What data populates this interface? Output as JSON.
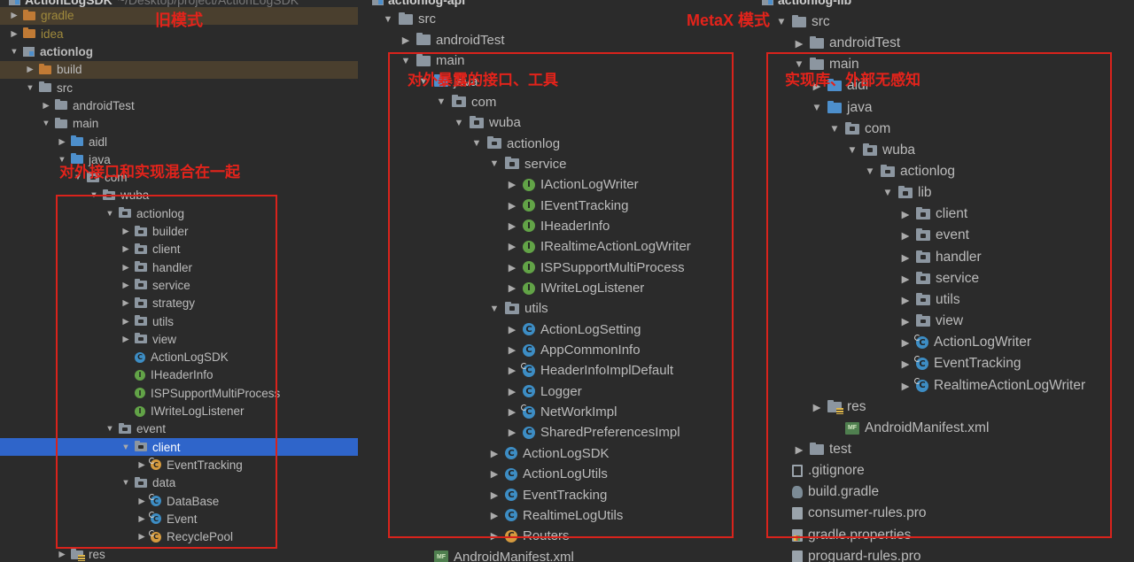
{
  "panel1": {
    "module_name": "ActionLogSDK",
    "module_path": "~/Desktop/project/ActionLogSDK",
    "annotation_top": "旧模式",
    "annotation_box": "对外接口和实现混合在一起",
    "rows": [
      {
        "indent": 1,
        "arrow": "▶",
        "icon": "folder",
        "color": "orange",
        "label": "gradle",
        "style": "excluded",
        "hl": "excluded"
      },
      {
        "indent": 1,
        "arrow": "▶",
        "icon": "folder",
        "color": "orange",
        "label": "idea",
        "style": "excluded"
      },
      {
        "indent": 1,
        "arrow": "▼",
        "icon": "module",
        "label": "actionlog",
        "style": "bold"
      },
      {
        "indent": 2,
        "arrow": "▶",
        "icon": "folder",
        "color": "orange",
        "label": "build",
        "hl": "excluded"
      },
      {
        "indent": 2,
        "arrow": "▼",
        "icon": "folder",
        "label": "src"
      },
      {
        "indent": 3,
        "arrow": "▶",
        "icon": "folder",
        "label": "androidTest"
      },
      {
        "indent": 3,
        "arrow": "▼",
        "icon": "folder",
        "label": "main"
      },
      {
        "indent": 4,
        "arrow": "▶",
        "icon": "folder",
        "color": "blue",
        "label": "aidl"
      },
      {
        "indent": 4,
        "arrow": "▼",
        "icon": "folder",
        "color": "blue",
        "label": "java"
      },
      {
        "indent": 5,
        "arrow": "▼",
        "icon": "folder",
        "pkg": true,
        "label": "com"
      },
      {
        "indent": 6,
        "arrow": "▼",
        "icon": "folder",
        "pkg": true,
        "label": "wuba"
      },
      {
        "indent": 7,
        "arrow": "▼",
        "icon": "folder",
        "pkg": true,
        "label": "actionlog"
      },
      {
        "indent": 8,
        "arrow": "▶",
        "icon": "folder",
        "pkg": true,
        "label": "builder"
      },
      {
        "indent": 8,
        "arrow": "▶",
        "icon": "folder",
        "pkg": true,
        "label": "client"
      },
      {
        "indent": 8,
        "arrow": "▶",
        "icon": "folder",
        "pkg": true,
        "label": "handler"
      },
      {
        "indent": 8,
        "arrow": "▶",
        "icon": "folder",
        "pkg": true,
        "label": "service"
      },
      {
        "indent": 8,
        "arrow": "▶",
        "icon": "folder",
        "pkg": true,
        "label": "strategy"
      },
      {
        "indent": 8,
        "arrow": "▶",
        "icon": "folder",
        "pkg": true,
        "label": "utils"
      },
      {
        "indent": 8,
        "arrow": "▶",
        "icon": "folder",
        "pkg": true,
        "label": "view"
      },
      {
        "indent": 8,
        "arrow": "",
        "icon": "class",
        "kind": "c",
        "label": "ActionLogSDK"
      },
      {
        "indent": 8,
        "arrow": "",
        "icon": "class",
        "kind": "i",
        "label": "IHeaderInfo"
      },
      {
        "indent": 8,
        "arrow": "",
        "icon": "class",
        "kind": "i",
        "label": "ISPSupportMultiProcess"
      },
      {
        "indent": 8,
        "arrow": "",
        "icon": "class",
        "kind": "i",
        "label": "IWriteLogListener"
      },
      {
        "indent": 7,
        "arrow": "▼",
        "icon": "folder",
        "pkg": true,
        "label": "event"
      },
      {
        "indent": 8,
        "arrow": "▼",
        "icon": "folder",
        "pkg": true,
        "label": "client",
        "hl": "selected"
      },
      {
        "indent": 9,
        "arrow": "▶",
        "icon": "class",
        "kind": "o",
        "sync": true,
        "label": "EventTracking"
      },
      {
        "indent": 8,
        "arrow": "▼",
        "icon": "folder",
        "pkg": true,
        "label": "data"
      },
      {
        "indent": 9,
        "arrow": "▶",
        "icon": "class",
        "kind": "c",
        "sync": true,
        "label": "DataBase"
      },
      {
        "indent": 9,
        "arrow": "▶",
        "icon": "class",
        "kind": "c",
        "sync": true,
        "label": "Event"
      },
      {
        "indent": 9,
        "arrow": "▶",
        "icon": "class",
        "kind": "o",
        "sync": true,
        "label": "RecyclePool"
      },
      {
        "indent": 4,
        "arrow": "▶",
        "icon": "folder",
        "res": true,
        "label": "res"
      }
    ]
  },
  "panel2": {
    "module_name": "actionlog-api",
    "annotation_box": "对外暴露的接口、工具",
    "rows": [
      {
        "indent": 1,
        "arrow": "▼",
        "icon": "folder",
        "label": "src"
      },
      {
        "indent": 2,
        "arrow": "▶",
        "icon": "folder",
        "label": "androidTest"
      },
      {
        "indent": 2,
        "arrow": "▼",
        "icon": "folder",
        "label": "main"
      },
      {
        "indent": 3,
        "arrow": "▼",
        "icon": "folder",
        "color": "blue",
        "label": "java"
      },
      {
        "indent": 4,
        "arrow": "▼",
        "icon": "folder",
        "pkg": true,
        "label": "com"
      },
      {
        "indent": 5,
        "arrow": "▼",
        "icon": "folder",
        "pkg": true,
        "label": "wuba"
      },
      {
        "indent": 6,
        "arrow": "▼",
        "icon": "folder",
        "pkg": true,
        "label": "actionlog"
      },
      {
        "indent": 7,
        "arrow": "▼",
        "icon": "folder",
        "pkg": true,
        "label": "service"
      },
      {
        "indent": 8,
        "arrow": "▶",
        "icon": "class",
        "kind": "i",
        "label": "IActionLogWriter"
      },
      {
        "indent": 8,
        "arrow": "▶",
        "icon": "class",
        "kind": "i",
        "label": "IEventTracking"
      },
      {
        "indent": 8,
        "arrow": "▶",
        "icon": "class",
        "kind": "i",
        "label": "IHeaderInfo"
      },
      {
        "indent": 8,
        "arrow": "▶",
        "icon": "class",
        "kind": "i",
        "label": "IRealtimeActionLogWriter"
      },
      {
        "indent": 8,
        "arrow": "▶",
        "icon": "class",
        "kind": "i",
        "label": "ISPSupportMultiProcess"
      },
      {
        "indent": 8,
        "arrow": "▶",
        "icon": "class",
        "kind": "i",
        "label": "IWriteLogListener"
      },
      {
        "indent": 7,
        "arrow": "▼",
        "icon": "folder",
        "pkg": true,
        "label": "utils"
      },
      {
        "indent": 8,
        "arrow": "▶",
        "icon": "class",
        "kind": "c",
        "label": "ActionLogSetting"
      },
      {
        "indent": 8,
        "arrow": "▶",
        "icon": "class",
        "kind": "c",
        "label": "AppCommonInfo"
      },
      {
        "indent": 8,
        "arrow": "▶",
        "icon": "class",
        "kind": "c",
        "sync": true,
        "label": "HeaderInfoImplDefault"
      },
      {
        "indent": 8,
        "arrow": "▶",
        "icon": "class",
        "kind": "c",
        "label": "Logger"
      },
      {
        "indent": 8,
        "arrow": "▶",
        "icon": "class",
        "kind": "c",
        "sync": true,
        "label": "NetWorkImpl"
      },
      {
        "indent": 8,
        "arrow": "▶",
        "icon": "class",
        "kind": "c",
        "label": "SharedPreferencesImpl"
      },
      {
        "indent": 7,
        "arrow": "▶",
        "icon": "class",
        "kind": "c",
        "label": "ActionLogSDK"
      },
      {
        "indent": 7,
        "arrow": "▶",
        "icon": "class",
        "kind": "c",
        "label": "ActionLogUtils"
      },
      {
        "indent": 7,
        "arrow": "▶",
        "icon": "class",
        "kind": "c",
        "label": "EventTracking"
      },
      {
        "indent": 7,
        "arrow": "▶",
        "icon": "class",
        "kind": "c",
        "label": "RealtimeLogUtils"
      },
      {
        "indent": 7,
        "arrow": "▶",
        "icon": "class",
        "kind": "o",
        "label": "Routers"
      },
      {
        "indent": 3,
        "arrow": "",
        "icon": "file",
        "ftype": "xml",
        "label": "AndroidManifest.xml"
      }
    ]
  },
  "panel3": {
    "module_name": "actionlog-lib",
    "annotation_top": "MetaX 模式",
    "annotation_box": "实现库、外部无感知",
    "rows": [
      {
        "indent": 1,
        "arrow": "▼",
        "icon": "folder",
        "label": "src"
      },
      {
        "indent": 2,
        "arrow": "▶",
        "icon": "folder",
        "label": "androidTest"
      },
      {
        "indent": 2,
        "arrow": "▼",
        "icon": "folder",
        "label": "main"
      },
      {
        "indent": 3,
        "arrow": "▶",
        "icon": "folder",
        "color": "blue",
        "label": "aidl"
      },
      {
        "indent": 3,
        "arrow": "▼",
        "icon": "folder",
        "color": "blue",
        "label": "java"
      },
      {
        "indent": 4,
        "arrow": "▼",
        "icon": "folder",
        "pkg": true,
        "label": "com"
      },
      {
        "indent": 5,
        "arrow": "▼",
        "icon": "folder",
        "pkg": true,
        "label": "wuba"
      },
      {
        "indent": 6,
        "arrow": "▼",
        "icon": "folder",
        "pkg": true,
        "label": "actionlog"
      },
      {
        "indent": 7,
        "arrow": "▼",
        "icon": "folder",
        "pkg": true,
        "label": "lib"
      },
      {
        "indent": 8,
        "arrow": "▶",
        "icon": "folder",
        "pkg": true,
        "label": "client"
      },
      {
        "indent": 8,
        "arrow": "▶",
        "icon": "folder",
        "pkg": true,
        "label": "event"
      },
      {
        "indent": 8,
        "arrow": "▶",
        "icon": "folder",
        "pkg": true,
        "label": "handler"
      },
      {
        "indent": 8,
        "arrow": "▶",
        "icon": "folder",
        "pkg": true,
        "label": "service"
      },
      {
        "indent": 8,
        "arrow": "▶",
        "icon": "folder",
        "pkg": true,
        "label": "utils"
      },
      {
        "indent": 8,
        "arrow": "▶",
        "icon": "folder",
        "pkg": true,
        "label": "view"
      },
      {
        "indent": 8,
        "arrow": "▶",
        "icon": "class",
        "kind": "c",
        "sync": true,
        "label": "ActionLogWriter"
      },
      {
        "indent": 8,
        "arrow": "▶",
        "icon": "class",
        "kind": "c",
        "sync": true,
        "label": "EventTracking"
      },
      {
        "indent": 8,
        "arrow": "▶",
        "icon": "class",
        "kind": "c",
        "sync": true,
        "label": "RealtimeActionLogWriter"
      },
      {
        "indent": 3,
        "arrow": "▶",
        "icon": "folder",
        "res": true,
        "label": "res"
      },
      {
        "indent": 4,
        "arrow": "",
        "icon": "file",
        "ftype": "xml",
        "label": "AndroidManifest.xml"
      },
      {
        "indent": 2,
        "arrow": "▶",
        "icon": "folder",
        "label": "test"
      },
      {
        "indent": 1,
        "arrow": "",
        "icon": "file",
        "ftype": "git",
        "label": ".gitignore"
      },
      {
        "indent": 1,
        "arrow": "",
        "icon": "file",
        "ftype": "gradle",
        "label": "build.gradle"
      },
      {
        "indent": 1,
        "arrow": "",
        "icon": "file",
        "ftype": "plain",
        "label": "consumer-rules.pro"
      },
      {
        "indent": 1,
        "arrow": "",
        "icon": "file",
        "ftype": "props",
        "label": "gradle.properties"
      },
      {
        "indent": 1,
        "arrow": "",
        "icon": "file",
        "ftype": "plain",
        "label": "proguard-rules.pro"
      }
    ]
  }
}
